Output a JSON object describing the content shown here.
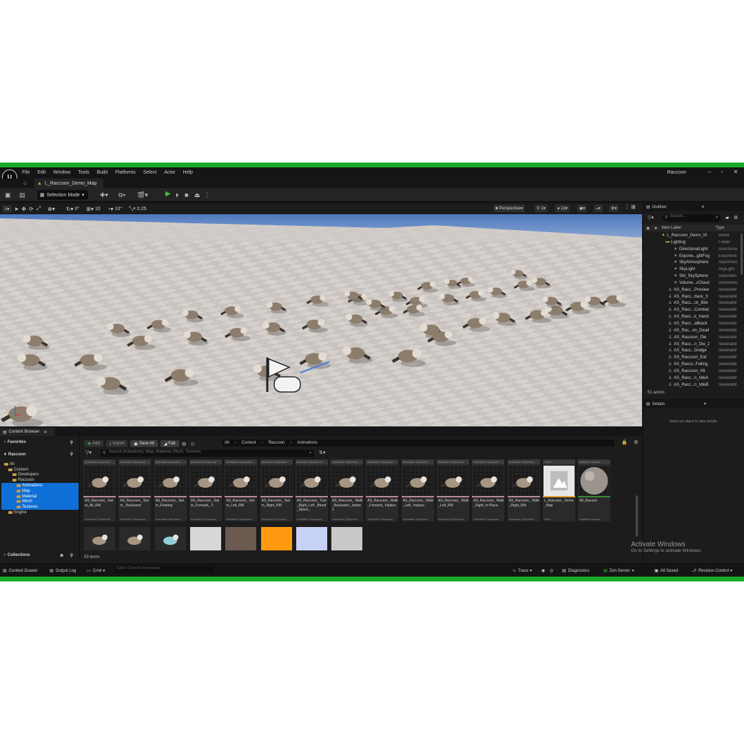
{
  "app": {
    "project_name": "Raccoon",
    "map_tab": "L_Raccoon_Demo_Map",
    "menu": [
      "File",
      "Edit",
      "Window",
      "Tools",
      "Build",
      "Platforms",
      "Select",
      "Actor",
      "Help"
    ]
  },
  "toolbar": {
    "selection_mode": "Selection Mode"
  },
  "viewport": {
    "rotation_snap_label": "0°",
    "grid_snap": "10",
    "rotate_snap": "10°",
    "scale_snap": "0.25",
    "camera_speed": "1",
    "perspective": "Perspective",
    "lit": "Lit",
    "floor_color": "#d9d4cf",
    "sky_color": "#5f87c7"
  },
  "outliner": {
    "title": "Outliner",
    "search_placeholder": "Search...",
    "col_label": "Item Label",
    "col_type": "Type",
    "rows": [
      {
        "label": "L_Raccoon_Demo_M",
        "type": "World"
      },
      {
        "label": "Lighting",
        "type": "Folder"
      },
      {
        "label": "DirectionalLight",
        "type": "Directiona"
      },
      {
        "label": "Expone...ghtFog",
        "type": "Exponenti"
      },
      {
        "label": "SkyAtmosphere",
        "type": "SkyAtmos"
      },
      {
        "label": "SkyLight",
        "type": "SkyLight"
      },
      {
        "label": "SM_SkySphere",
        "type": "StaticMes"
      },
      {
        "label": "Volume...cCloud",
        "type": "Volumetric"
      },
      {
        "label": "AS_Racc...Preview",
        "type": "SkeletalM"
      },
      {
        "label": "AS_Racc...ttack_3",
        "type": "SkeletalM"
      },
      {
        "label": "AS_Racc...ck_Bite",
        "type": "SkeletalM"
      },
      {
        "label": "AS_Racc...Combat",
        "type": "SkeletalM"
      },
      {
        "label": "AS_Racc...k_Hand",
        "type": "SkeletalM"
      },
      {
        "label": "AS_Racc...allback",
        "type": "SkeletalM"
      },
      {
        "label": "AS_Rac...on_Dead",
        "type": "SkeletalM"
      },
      {
        "label": "AS_Raccoon_Die",
        "type": "SkeletalM"
      },
      {
        "label": "AS_Racc...n_Die_2",
        "type": "SkeletalM"
      },
      {
        "label": "AS_Racc...Dodge",
        "type": "SkeletalM"
      },
      {
        "label": "AS_Raccoon_Eat",
        "type": "SkeletalM"
      },
      {
        "label": "AS_Racco..Falling",
        "type": "SkeletalM"
      },
      {
        "label": "AS_Raccoon_Hit",
        "type": "SkeletalM"
      },
      {
        "label": "AS_Racc...n_IdleA",
        "type": "SkeletalM"
      },
      {
        "label": "AS_Racc...n_IdleB",
        "type": "SkeletalM"
      }
    ],
    "actor_count": "51 actors"
  },
  "details": {
    "title": "Details",
    "empty_message": "Select an object to view details."
  },
  "content_browser": {
    "tab": "Content Browser",
    "favorites": "Favorites",
    "root_folder": "Raccoon",
    "tree": [
      {
        "label": "All",
        "depth": 0,
        "selected": false
      },
      {
        "label": "Content",
        "depth": 1,
        "selected": false
      },
      {
        "label": "Developers",
        "depth": 2,
        "selected": false
      },
      {
        "label": "Raccoon",
        "depth": 2,
        "selected": false
      },
      {
        "label": "Animations",
        "depth": 3,
        "selected": true
      },
      {
        "label": "Map",
        "depth": 3,
        "selected": true
      },
      {
        "label": "Material",
        "depth": 3,
        "selected": true
      },
      {
        "label": "Mesh",
        "depth": 3,
        "selected": true
      },
      {
        "label": "Textures",
        "depth": 3,
        "selected": true
      },
      {
        "label": "Engine",
        "depth": 1,
        "selected": false
      }
    ],
    "collections": "Collections",
    "btn_add": "Add",
    "btn_import": "Import",
    "btn_save_all": "Save All",
    "btn_fab": "Fab",
    "path": [
      "All",
      "Content",
      "Raccoon",
      "Animations"
    ],
    "filter_placeholder": "Search Animations, Map, Material, Mesh, Textures",
    "assets": [
      {
        "name": "AS_Raccoon_ Swim_All_RM",
        "cls": "Animation Sequence"
      },
      {
        "name": "AS_Raccoon_ Swim_ Backward",
        "cls": "Animation Sequence"
      },
      {
        "name": "AS_Raccoon_ Swim_Floating",
        "cls": "Animation Sequence"
      },
      {
        "name": "AS_Raccoon_ Swim_Forward_ 2",
        "cls": "Animation Sequence"
      },
      {
        "name": "AS_Raccoon_ Swim_Left_RM",
        "cls": "Animation Sequence"
      },
      {
        "name": "AS_Raccoon_ Swim_Right_RM",
        "cls": "Animation Sequence"
      },
      {
        "name": "AS_Raccoon_ Turn_Right_Left _Blend_Space_",
        "cls": "Animation Sequence"
      },
      {
        "name": "AS_Raccoon_ Walk_Backward _Inplace",
        "cls": "Animation Sequence"
      },
      {
        "name": "AS_Raccoon_ Walk_Forward_ Inplace",
        "cls": "Animation Sequence"
      },
      {
        "name": "AS_Raccoon_ Walk_Left_ Inplace",
        "cls": "Animation Sequence"
      },
      {
        "name": "AS_Raccoon_ Walk_Left_RM",
        "cls": "Animation Sequence"
      },
      {
        "name": "AS_Raccoon_ Walk_Right_In Place",
        "cls": "Animation Sequence"
      },
      {
        "name": "AS_Raccoon_ Walk_Right_RM",
        "cls": "Animation Sequence"
      },
      {
        "name": "L_Raccoon_ Demo_Map",
        "cls": "Level"
      },
      {
        "name": "MI_Racoon",
        "cls": "Material Instance"
      }
    ],
    "item_count": "53 items"
  },
  "statusbar": {
    "content_drawer": "Content Drawer",
    "output_log": "Output Log",
    "cmd": "Cmd",
    "console_placeholder": "Enter Console Command",
    "trace": "Trace",
    "diagnostics": "Diagnostics",
    "zen_server": "Zen Server",
    "all_saved": "All Saved",
    "revision_control": "Revision Control"
  },
  "watermark": {
    "line1": "Activate Windows",
    "line2": "Go to Settings to activate Windows."
  }
}
